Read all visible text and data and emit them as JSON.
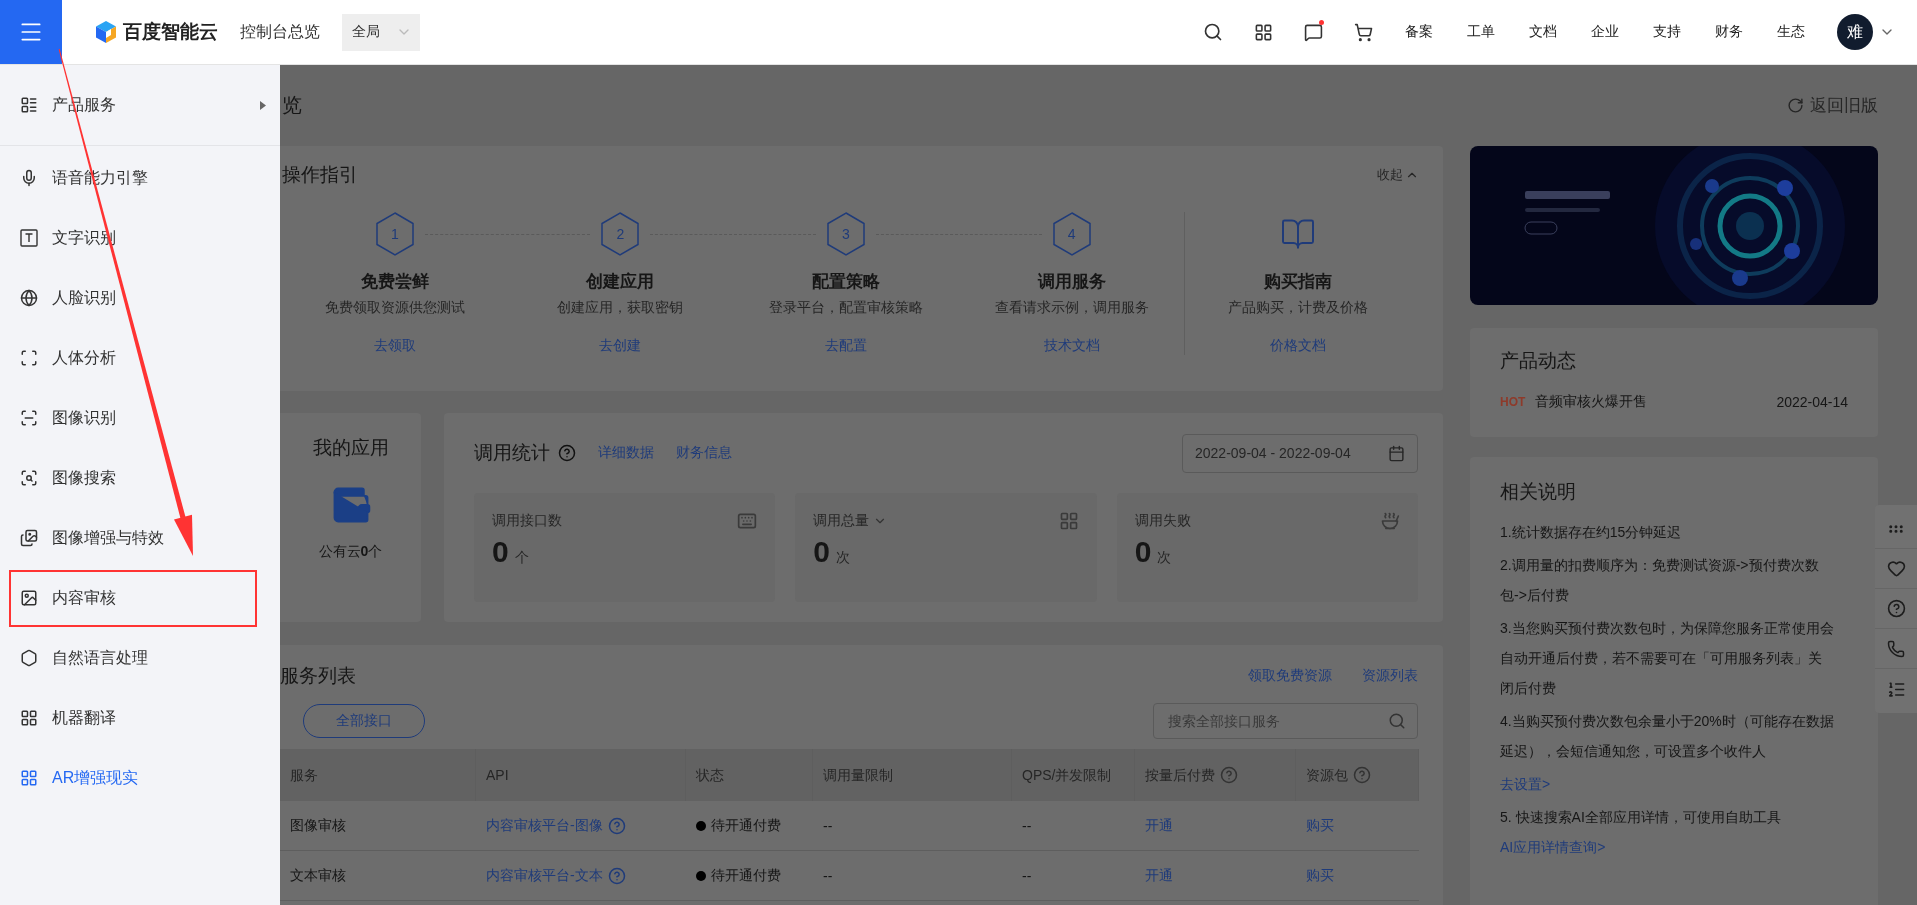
{
  "topbar": {
    "logo": "百度智能云",
    "console_title": "控制台总览",
    "region_select": "全局",
    "unread_messages": true,
    "nav_links": [
      "备案",
      "工单",
      "文档",
      "企业",
      "支持",
      "财务",
      "生态"
    ],
    "avatar": "难"
  },
  "sidebar": {
    "header": "产品服务",
    "items": [
      {
        "label": "语音能力引擎",
        "selected": false
      },
      {
        "label": "文字识别",
        "selected": false
      },
      {
        "label": "人脸识别",
        "selected": false
      },
      {
        "label": "人体分析",
        "selected": false
      },
      {
        "label": "图像识别",
        "selected": false
      },
      {
        "label": "图像搜索",
        "selected": false
      },
      {
        "label": "图像增强与特效",
        "selected": false
      },
      {
        "label": "内容审核",
        "selected": false
      },
      {
        "label": "自然语言处理",
        "selected": false
      },
      {
        "label": "机器翻译",
        "selected": false
      },
      {
        "label": "AR增强现实",
        "selected": true
      }
    ]
  },
  "page": {
    "title": "览",
    "return_link": "返回旧版"
  },
  "guide": {
    "title": "操作指引",
    "collapse": "收起",
    "steps": [
      {
        "kind": "step",
        "number": "1",
        "title": "免费尝鲜",
        "desc": "免费领取资源供您测试",
        "link": "去领取"
      },
      {
        "kind": "step",
        "number": "2",
        "title": "创建应用",
        "desc": "创建应用，获取密钥",
        "link": "去创建"
      },
      {
        "kind": "step",
        "number": "3",
        "title": "配置策略",
        "desc": "登录平台，配置审核策略",
        "link": "去配置"
      },
      {
        "kind": "step",
        "number": "4",
        "title": "调用服务",
        "desc": "查看请求示例，调用服务",
        "link": "技术文档"
      },
      {
        "kind": "book",
        "title": "购买指南",
        "desc": "产品购买，计费及价格",
        "link": "价格文档"
      }
    ]
  },
  "my_apps": {
    "title": "我的应用",
    "caption": "公有云**0**个"
  },
  "stats": {
    "title": "调用统计",
    "links": [
      "详细数据",
      "财务信息"
    ],
    "date_range": "2022-09-04 - 2022-09-04",
    "cards": [
      {
        "label": "调用接口数",
        "value": "0",
        "unit": "个",
        "dropdown": false
      },
      {
        "label": "调用总量",
        "value": "0",
        "unit": "次",
        "dropdown": true
      },
      {
        "label": "调用失败",
        "value": "0",
        "unit": "次",
        "dropdown": false
      }
    ]
  },
  "services": {
    "title": "服务列表",
    "links": [
      "领取免费资源",
      "资源列表"
    ],
    "filter": "全部接口",
    "search_placeholder": "搜索全部接口服务",
    "columns": [
      {
        "label": "服务",
        "help": false
      },
      {
        "label": "API",
        "help": false
      },
      {
        "label": "状态",
        "help": false
      },
      {
        "label": "调用量限制",
        "help": false
      },
      {
        "label": "QPS/并发限制",
        "help": false
      },
      {
        "label": "按量后付费",
        "help": true
      },
      {
        "label": "资源包",
        "help": true
      }
    ],
    "rows": [
      {
        "service": "图像审核",
        "api": "内容审核平台-图像",
        "api_help": true,
        "status": "待开通付费",
        "quota": "--",
        "qps": "--",
        "postpaid": "开通",
        "package": "购买"
      },
      {
        "service": "文本审核",
        "api": "内容审核平台-文本",
        "api_help": true,
        "status": "待开通付费",
        "quota": "--",
        "qps": "--",
        "postpaid": "开通",
        "package": "购买"
      }
    ]
  },
  "news": {
    "title": "产品动态",
    "items": [
      {
        "tag": "HOT",
        "text": "音频审核火爆开售",
        "date": "2022-04-14"
      }
    ]
  },
  "notes": {
    "title": "相关说明",
    "items": [
      {
        "kind": "paragraph",
        "text": "1.统计数据存在约15分钟延迟"
      },
      {
        "kind": "paragraph",
        "text": "2.调用量的扣费顺序为：免费测试资源->预付费次数包->后付费"
      },
      {
        "kind": "paragraph",
        "text": "3.当您购买预付费次数包时，为保障您服务正常使用会自动开通后付费，若不需要可在「可用服务列表」关闭后付费"
      },
      {
        "kind": "paragraph",
        "text": "4.当购买预付费次数包余量小于20%时（可能存在数据延迟），会短信通知您，可设置多个收件人"
      },
      {
        "kind": "link",
        "text": "去设置>"
      },
      {
        "kind": "paragraph",
        "text": "5. 快速搜索AI全部应用详情，可使用自助工具",
        "link": "AI应用详情查询>"
      }
    ]
  }
}
